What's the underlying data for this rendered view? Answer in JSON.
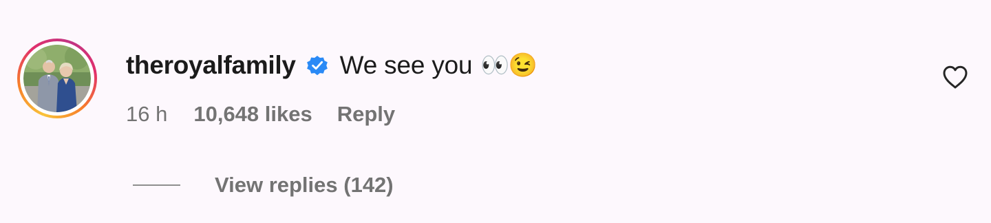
{
  "comment": {
    "username": "theroyalfamily",
    "verified": true,
    "text": "We see you",
    "emojis": "👀😉",
    "time": "16 h",
    "likes": "10,648 likes",
    "reply_label": "Reply",
    "view_replies_label": "View replies (142)"
  },
  "icons": {
    "verified": "verified-badge-icon",
    "like": "heart-outline-icon"
  },
  "colors": {
    "background": "#fdf8fd",
    "verified_blue": "#2a8af6",
    "meta_gray": "#737373"
  }
}
